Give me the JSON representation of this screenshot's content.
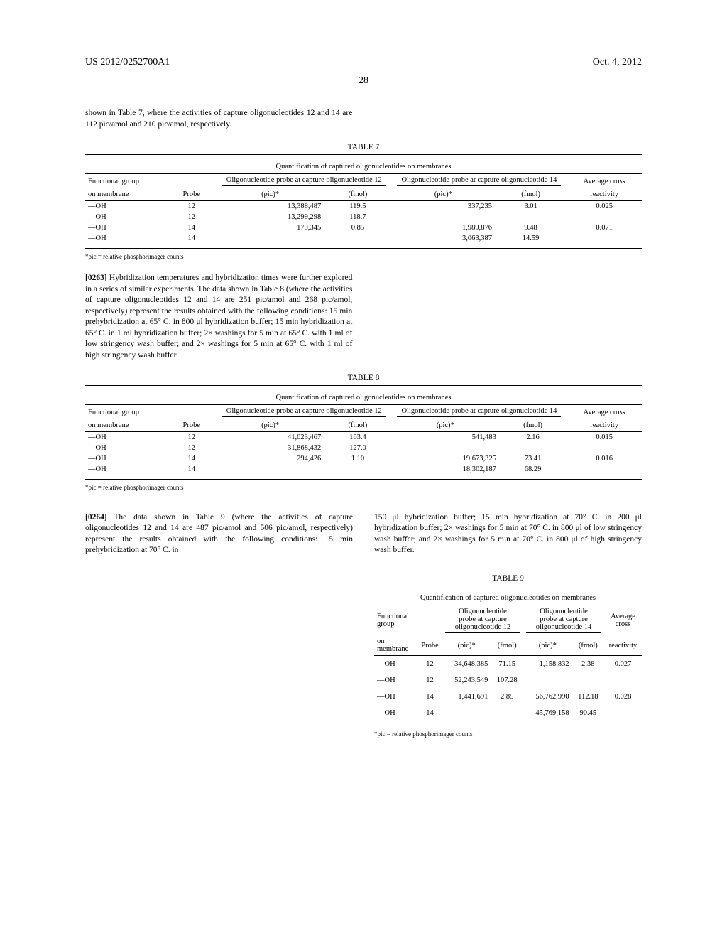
{
  "header": {
    "pub_number": "US 2012/0252700A1",
    "date": "Oct. 4, 2012",
    "page_number": "28"
  },
  "intro_text": "shown in Table 7, where the activities of capture oligonucleotides 12 and 14 are 112 pic/amol and 210 pic/amol, respectively.",
  "table7": {
    "label": "TABLE 7",
    "title": "Quantification of captured oligonucleotides on membranes",
    "col_func": "Functional group",
    "col_membrane": "on membrane",
    "col_probe": "Probe",
    "col12": "Oligonucleotide probe at capture oligonucleotide 12",
    "col14": "Oligonucleotide probe at capture oligonucleotide 14",
    "col_avg": "Average cross",
    "col_react": "reactivity",
    "col_pic": "(pic)*",
    "col_fmol": "(fmol)",
    "rows": [
      {
        "g": "—OH",
        "p": "12",
        "p12": "13,388,487",
        "f12": "119.5",
        "p14": "337,235",
        "f14": "3.01",
        "r": "0.025"
      },
      {
        "g": "—OH",
        "p": "12",
        "p12": "13,299,298",
        "f12": "118.7",
        "p14": "",
        "f14": "",
        "r": ""
      },
      {
        "g": "—OH",
        "p": "14",
        "p12": "179,345",
        "f12": "0.85",
        "p14": "1,989,876",
        "f14": "9.48",
        "r": "0.071"
      },
      {
        "g": "—OH",
        "p": "14",
        "p12": "",
        "f12": "",
        "p14": "3,063,387",
        "f14": "14.59",
        "r": ""
      }
    ],
    "footnote": "*pic = relative phosphorimager counts"
  },
  "para263": {
    "num": "[0263]",
    "text": "Hybridization temperatures and hybridization times were further explored in a series of similar experiments. The data shown in Table 8 (where the activities of capture oligonucleotides 12 and 14 are 251 pic/amol and 268 pic/amol, respectively) represent the results obtained with the following conditions: 15 min prehybridization at 65° C. in 800 μl hybridization buffer; 15 min hybridization at 65° C. in 1 ml hybridization buffer; 2× washings for 5 min at 65° C. with 1 ml of low stringency wash buffer; and 2× washings for 5 min at 65° C. with 1 ml of high stringency wash buffer."
  },
  "table8": {
    "label": "TABLE 8",
    "title": "Quantification of captured oligonucleotides on membranes",
    "rows": [
      {
        "g": "—OH",
        "p": "12",
        "p12": "41,023,467",
        "f12": "163.4",
        "p14": "541,483",
        "f14": "2.16",
        "r": "0.015"
      },
      {
        "g": "—OH",
        "p": "12",
        "p12": "31,868,432",
        "f12": "127.0",
        "p14": "",
        "f14": "",
        "r": ""
      },
      {
        "g": "—OH",
        "p": "14",
        "p12": "294,426",
        "f12": "1.10",
        "p14": "19,673,325",
        "f14": "73.41",
        "r": "0.016"
      },
      {
        "g": "—OH",
        "p": "14",
        "p12": "",
        "f12": "",
        "p14": "18,302,187",
        "f14": "68.29",
        "r": ""
      }
    ],
    "footnote": "*pic = relative phosphorimager counts"
  },
  "para264": {
    "num": "[0264]",
    "text_left": "The data shown in Table 9 (where the activities of capture oligonucleotides 12 and 14 are 487 pic/amol and 506 pic/amol, respectively) represent the results obtained with the following conditions: 15 min prehybridization at 70° C. in",
    "text_right": "150 μl hybridization buffer; 15 min hybridization at 70° C. in 200 μl hybridization buffer; 2× washings for 5 min at 70° C. in 800 μl of low stringency wash buffer; and 2× washings for 5 min at 70° C. in 800 μl of high stringency wash buffer."
  },
  "table9": {
    "label": "TABLE 9",
    "title": "Quantification of captured oligonucleotides on membranes",
    "rows": [
      {
        "g": "—OH",
        "p": "12",
        "p12": "34,648,385",
        "f12": "71.15",
        "p14": "1,158,832",
        "f14": "2.38",
        "r": "0.027"
      },
      {
        "g": "—OH",
        "p": "12",
        "p12": "52,243,549",
        "f12": "107.28",
        "p14": "",
        "f14": "",
        "r": ""
      },
      {
        "g": "—OH",
        "p": "14",
        "p12": "1,441,691",
        "f12": "2.85",
        "p14": "56,762,990",
        "f14": "112.18",
        "r": "0.028"
      },
      {
        "g": "—OH",
        "p": "14",
        "p12": "",
        "f12": "",
        "p14": "45,769,158",
        "f14": "90.45",
        "r": ""
      }
    ],
    "footnote": "*pic = relative phosphorimager counts"
  }
}
